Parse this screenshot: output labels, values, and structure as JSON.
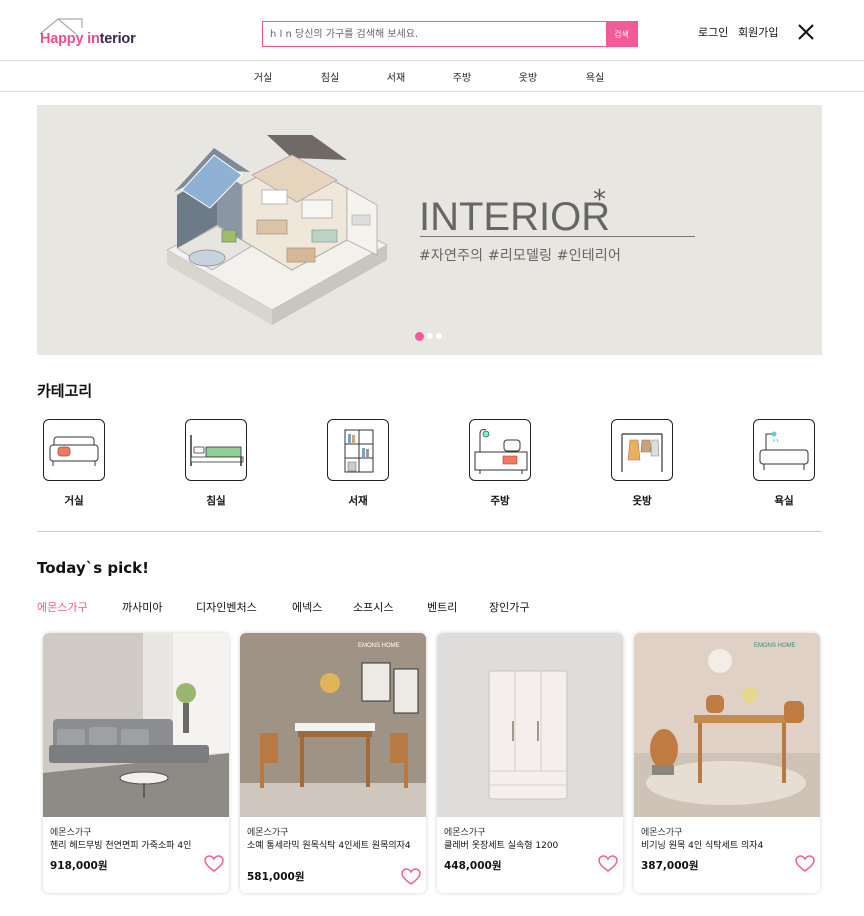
{
  "header": {
    "logo_happy": "Happy ",
    "logo_i": "in",
    "logo_rest": "terior",
    "search_placeholder": "h l n 당신의 가구를 검색해 보세요.",
    "search_button": "검색",
    "login": "로그인",
    "signup": "회원가입",
    "close_icon": "close-icon"
  },
  "nav": [
    "거실",
    "침실",
    "서재",
    "주방",
    "옷방",
    "욕실"
  ],
  "banner": {
    "title": "INTERIOR",
    "star": "*",
    "tags": "#자연주의  #리모델링  #인테리어",
    "slides": 3,
    "active_slide": 1
  },
  "categories": {
    "title": "카테고리",
    "items": [
      {
        "label": "거실",
        "icon": "sofa-icon"
      },
      {
        "label": "침실",
        "icon": "bed-icon"
      },
      {
        "label": "서재",
        "icon": "bookshelf-icon"
      },
      {
        "label": "주방",
        "icon": "kitchen-icon"
      },
      {
        "label": "옷방",
        "icon": "clothes-rack-icon"
      },
      {
        "label": "욕실",
        "icon": "bathtub-icon"
      }
    ]
  },
  "picks": {
    "title": "Today`s pick!",
    "tabs": [
      "에몬스가구",
      "까사미아",
      "디자인벤처스",
      "에넥스",
      "소프시스",
      "벤트리",
      "장인가구"
    ],
    "active_tab": 0,
    "products": [
      {
        "brand": "에몬스가구",
        "name": "헨리 헤드무빙 천연면피 가죽소파 4인",
        "price": "918,000원",
        "image": "grey-sofa"
      },
      {
        "brand": "에몬스가구",
        "name": "소예 통세라믹 원목식탁 4인세트 원목의자4",
        "price": "581,000원",
        "image": "dining-set"
      },
      {
        "brand": "에몬스가구",
        "name": "클레버 옷장세트 실속형 1200",
        "price": "448,000원",
        "image": "wardrobe"
      },
      {
        "brand": "에몬스가구",
        "name": "비기닝 원목 4인 식탁세트 의자4",
        "price": "387,000원",
        "image": "wood-dining"
      }
    ]
  },
  "colors": {
    "accent": "#f05b98",
    "banner_bg": "#e8e6e1"
  }
}
